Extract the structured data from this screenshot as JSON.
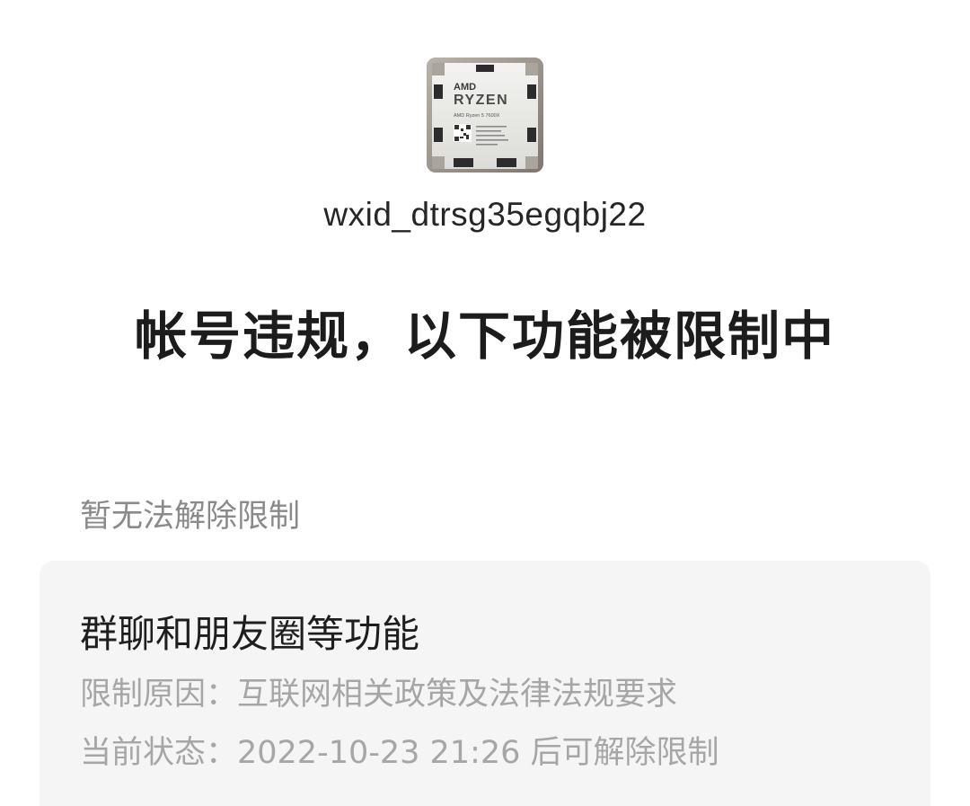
{
  "profile": {
    "account_id": "wxid_dtrsg35egqbj22",
    "avatar": {
      "icon": "cpu-chip-photo-icon",
      "brand_line1": "AMD",
      "brand_line2": "RYZEN",
      "model_line": "AMD Ryzen 5 7600X"
    }
  },
  "title": "帐号违规，以下功能被限制中",
  "section_label": "暂无法解除限制",
  "restriction": {
    "title": "群聊和朋友圈等功能",
    "reason": "限制原因：互联网相关政策及法律法规要求",
    "status": "当前状态：2022-10-23 21:26 后可解除限制"
  },
  "colors": {
    "background": "#ffffff",
    "card_background": "#f5f5f5",
    "title_text": "#1c1c1c",
    "muted_text": "#a6a6a6"
  }
}
